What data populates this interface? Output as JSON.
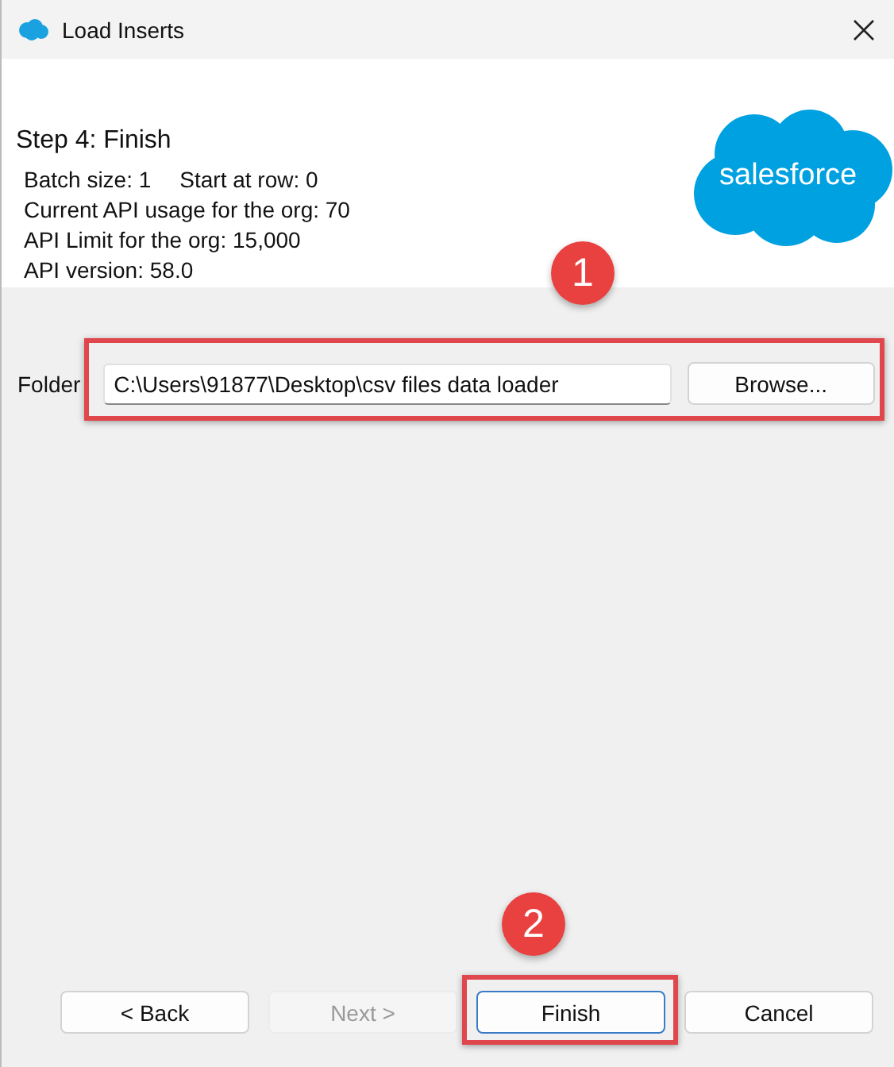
{
  "window": {
    "title": "Load Inserts"
  },
  "header": {
    "step_title": "Step 4: Finish",
    "details": [
      [
        "Batch size: 1",
        "Start at row: 0"
      ],
      [
        "Current API usage for the org: 70"
      ],
      [
        "API Limit for the org: 15,000"
      ],
      [
        "API version: 58.0"
      ]
    ],
    "logo": "salesforce"
  },
  "folder": {
    "label": "Folder",
    "value": "C:\\Users\\91877\\Desktop\\csv files data loader",
    "button": "Browse...",
    "callout": "1"
  },
  "buttons": [
    {
      "label": "< Back",
      "disabled": false,
      "focused": false
    },
    {
      "label": "Next >",
      "disabled": true,
      "focused": false
    },
    {
      "label": "Finish",
      "disabled": false,
      "focused": true,
      "callout": "2"
    },
    {
      "label": "Cancel",
      "disabled": false,
      "focused": false
    }
  ]
}
